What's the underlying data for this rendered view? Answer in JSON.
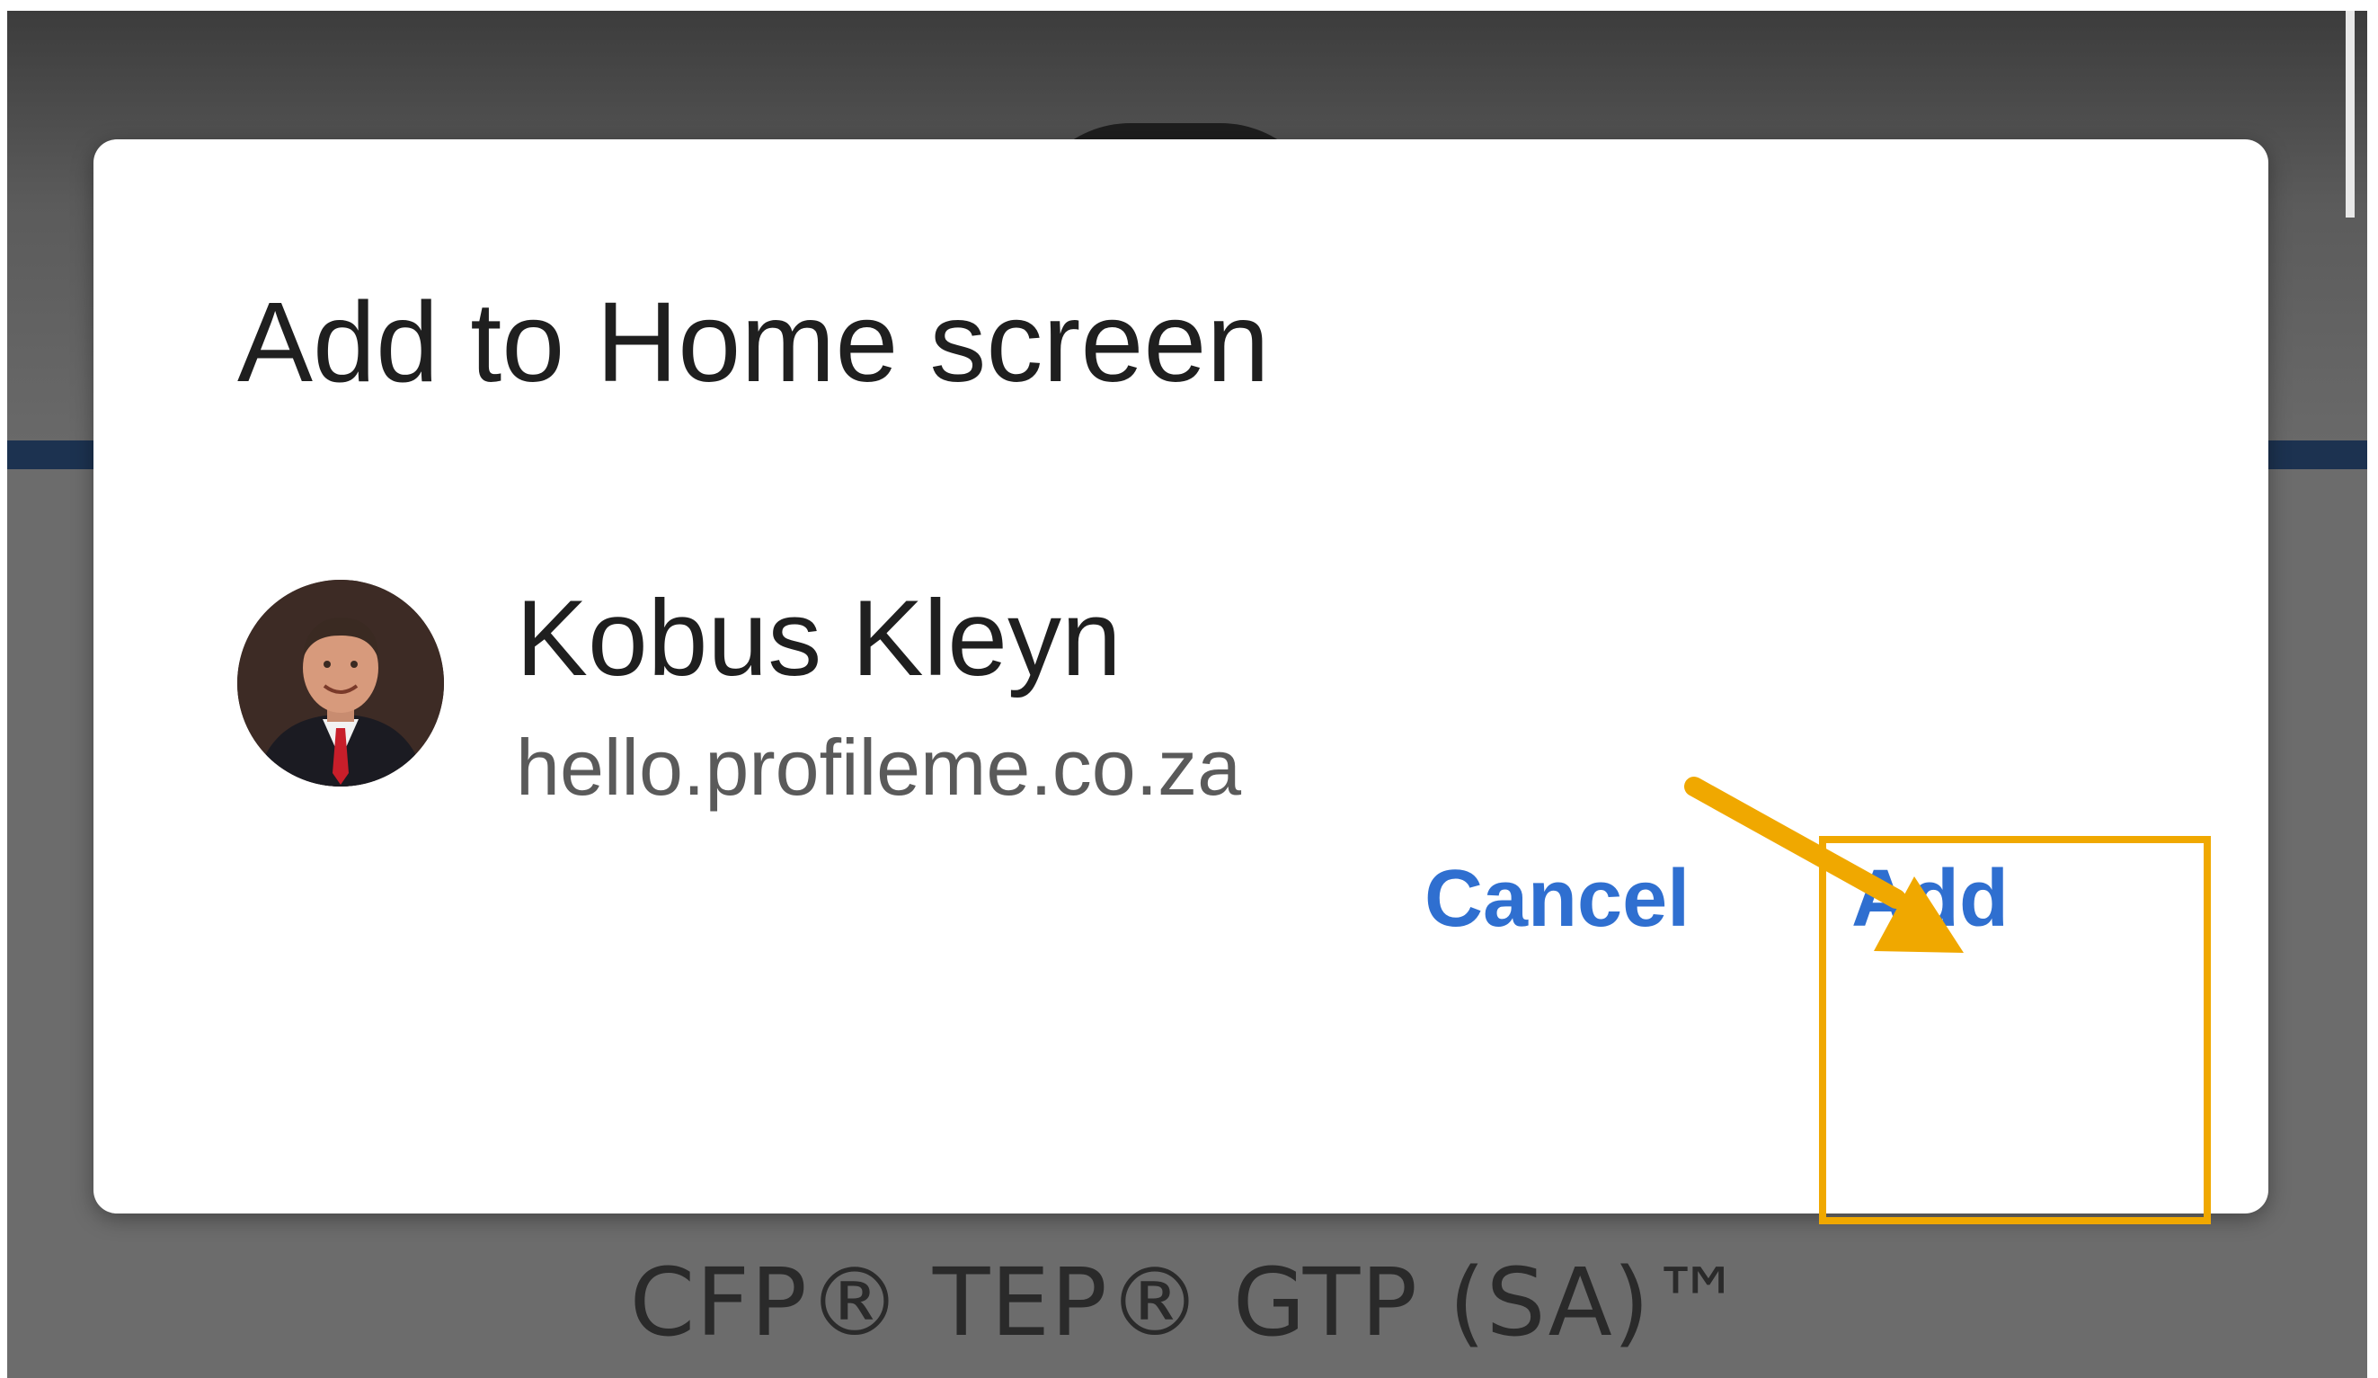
{
  "background": {
    "caption": "CFP® TEP® GTP (SA)™"
  },
  "dialog": {
    "title": "Add to Home screen",
    "app": {
      "name": "Kobus Kleyn",
      "url": "hello.profileme.co.za",
      "avatar": "profile-photo"
    },
    "buttons": {
      "cancel_label": "Cancel",
      "add_label": "Add"
    }
  },
  "annotation": {
    "highlight_color": "#f0a800",
    "arrow_icon": "arrow-pointing-to-add"
  },
  "colors": {
    "button_text": "#2f6fd0",
    "title_text": "#1f1f1f",
    "url_text": "#5a5a5a"
  }
}
